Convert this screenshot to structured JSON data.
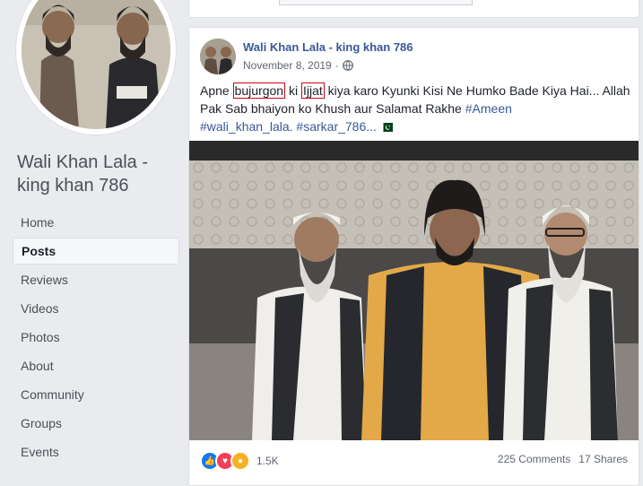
{
  "page": {
    "name": "Wali Khan Lala - king khan 786"
  },
  "nav": {
    "items": [
      "Home",
      "Posts",
      "Reviews",
      "Videos",
      "Photos",
      "About",
      "Community",
      "Groups",
      "Events"
    ],
    "active_index": 1
  },
  "post": {
    "author": "Wali Khan Lala - king khan 786",
    "date": "November 8, 2019",
    "privacy_icon": "globe-icon",
    "text": {
      "t1": "Apne ",
      "hl1": "bujurgon",
      "t2": " ki ",
      "hl2": "Ijjat",
      "t3": " kiya karo Kyunki Kisi Ne Humko Bade Kiya Hai... Allah Pak Sab bhaiyon ko Khush aur Salamat Rakhe ",
      "tag1": "#Ameen",
      "tag2": "#wali_khan_lala.",
      "tag3": "#sarkar_786",
      "t4": "...",
      "flag_icon": "pakistan-flag-icon"
    },
    "reactions": {
      "icons": [
        "like-icon",
        "love-icon",
        "wow-icon"
      ],
      "count": "1.5K"
    },
    "comments": "225 Comments",
    "shares": "17 Shares"
  },
  "colors": {
    "link": "#385898",
    "highlight_box": "#d0021b",
    "like": "#1877f2",
    "love": "#f33e58",
    "wow": "#f7b125"
  }
}
